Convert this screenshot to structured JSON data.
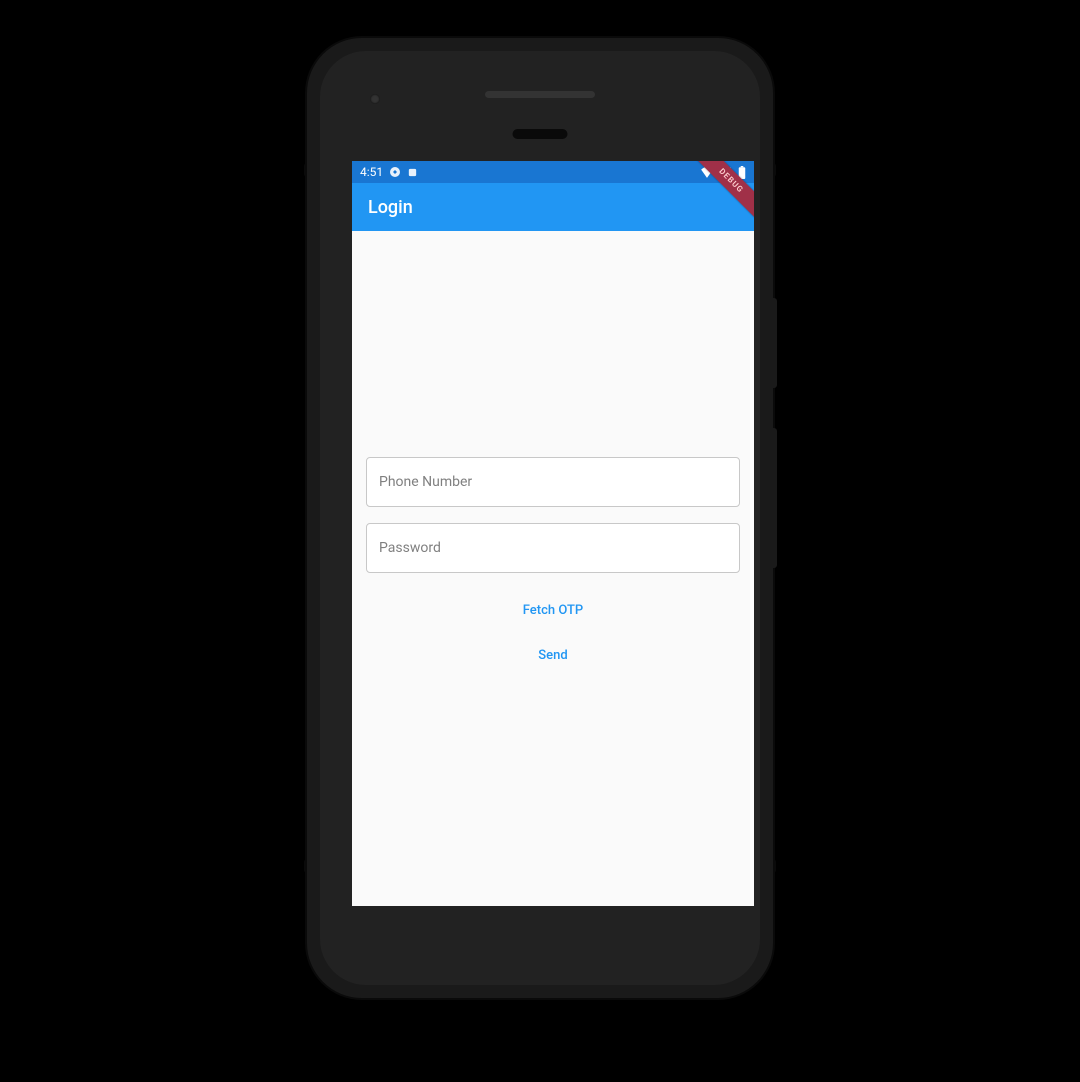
{
  "status_bar": {
    "time": "4:51"
  },
  "app_bar": {
    "title": "Login"
  },
  "debug": {
    "label": "DEBUG"
  },
  "form": {
    "phone_placeholder": "Phone Number",
    "phone_value": "",
    "password_placeholder": "Password",
    "password_value": ""
  },
  "actions": {
    "fetch_otp": "Fetch OTP",
    "send": "Send"
  },
  "colors": {
    "primary": "#2196f3",
    "primary_dark": "#1976d2",
    "background": "#fafafa"
  }
}
